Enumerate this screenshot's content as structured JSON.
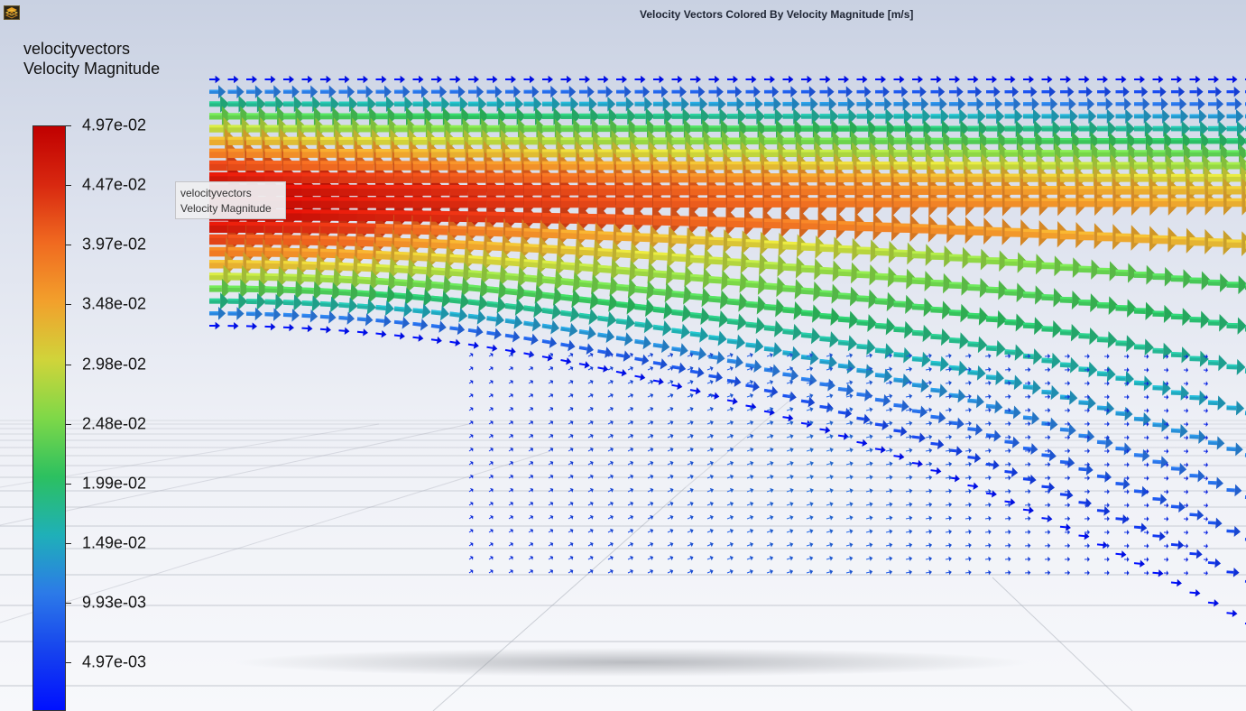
{
  "window": {
    "title": "Velocity Vectors Colored By Velocity Magnitude [m/s]",
    "logo_icon": "fluent-app-icon"
  },
  "legend": {
    "name": "velocityvectors",
    "variable": "Velocity Magnitude",
    "ticks": [
      "4.97e-02",
      "4.47e-02",
      "3.97e-02",
      "3.48e-02",
      "2.98e-02",
      "2.48e-02",
      "1.99e-02",
      "1.49e-02",
      "9.93e-03",
      "4.97e-03"
    ],
    "colormap": [
      "#0010ff",
      "#1642ee",
      "#2c7ae8",
      "#1fb0b8",
      "#2cc060",
      "#7ed848",
      "#d0d43a",
      "#f2a02c",
      "#f06a20",
      "#d82810",
      "#c00000"
    ]
  },
  "tooltip": {
    "line1": "velocityvectors",
    "line2": "Velocity Magnitude"
  },
  "colors": {
    "background_top": "#c9d1e2",
    "background_bottom": "#f7f8fb",
    "grid": "#9aa0ab"
  }
}
